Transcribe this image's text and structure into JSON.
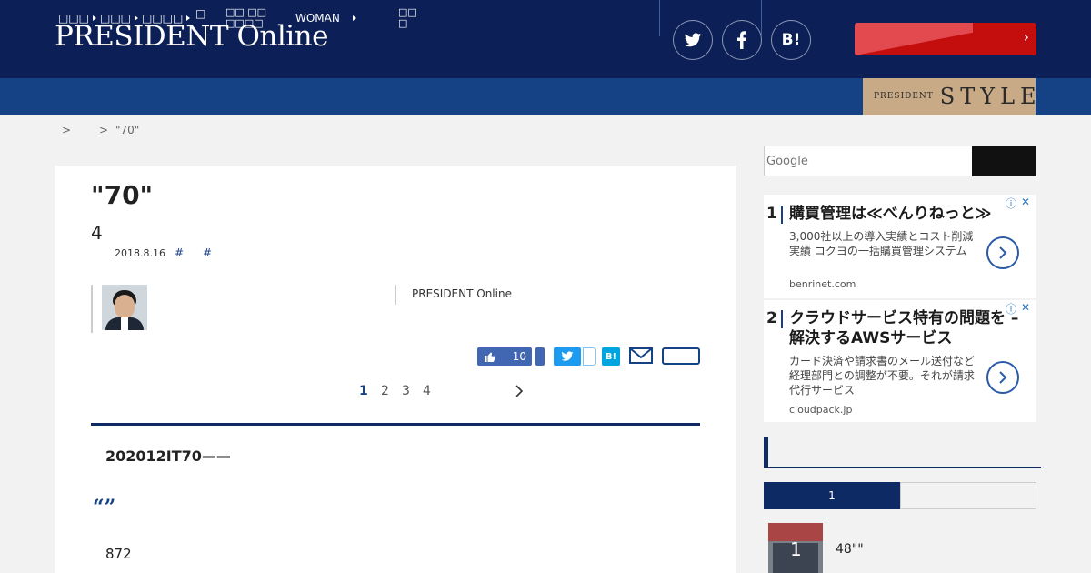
{
  "header": {
    "logo": "PRESIDENT Online",
    "social": [
      {
        "name": "twitter-icon",
        "glyph": "🐦"
      },
      {
        "name": "facebook-icon",
        "glyph": "f"
      },
      {
        "name": "hatena-bookmark-icon",
        "glyph": "B!"
      }
    ],
    "promo_chevron": "›"
  },
  "nav": {
    "items": [
      "□□□",
      "□□□",
      "□□□□",
      "□",
      "□□ □□ □□□□",
      "WOMAN",
      "□□ □"
    ],
    "woman_label": "WOMAN",
    "style_banner": {
      "small": "PRESIDENT",
      "large": "STYLE"
    }
  },
  "breadcrumb": {
    "sep1": ">",
    "sep2": ">",
    "current": "\"70\""
  },
  "article": {
    "title": "\"70\"",
    "page_total": "4",
    "date": "2018.8.16",
    "tags": [
      "#",
      "#"
    ],
    "publisher": "PRESIDENT Online",
    "like_count": "10",
    "share_hatena": "B!",
    "pages": [
      "1",
      "2",
      "3",
      "4"
    ],
    "current_page": "1",
    "next_chevron": "›",
    "lead": "202012IT70——",
    "quote": "“”",
    "body": "872"
  },
  "sidebar": {
    "search_placeholder": "Google",
    "ads": [
      {
        "num": "1",
        "headline": "購買管理は≪べんりねっと≫",
        "desc": "3,000社以上の導入実績とコスト削減実績 コクヨの一括購買管理システム",
        "domain": "benrinet.com"
      },
      {
        "num": "2",
        "headline": "クラウドサービス特有の問題を – 解決するAWSサービス",
        "desc": "カード決済や請求書のメール送付など経理部門との調整が不要。それが請求代行サービス",
        "domain": "cloudpack.jp"
      }
    ],
    "ad_choices": "ⓘ",
    "ad_close": "✕",
    "ranking": {
      "tab_active": "1",
      "item_rank": "1",
      "item_text": "48\"\""
    }
  },
  "colors": {
    "header_bg": "#0c2057",
    "nav_bg": "#154285",
    "accent_red": "#c40e0e",
    "style_gold": "#c9aa86"
  }
}
